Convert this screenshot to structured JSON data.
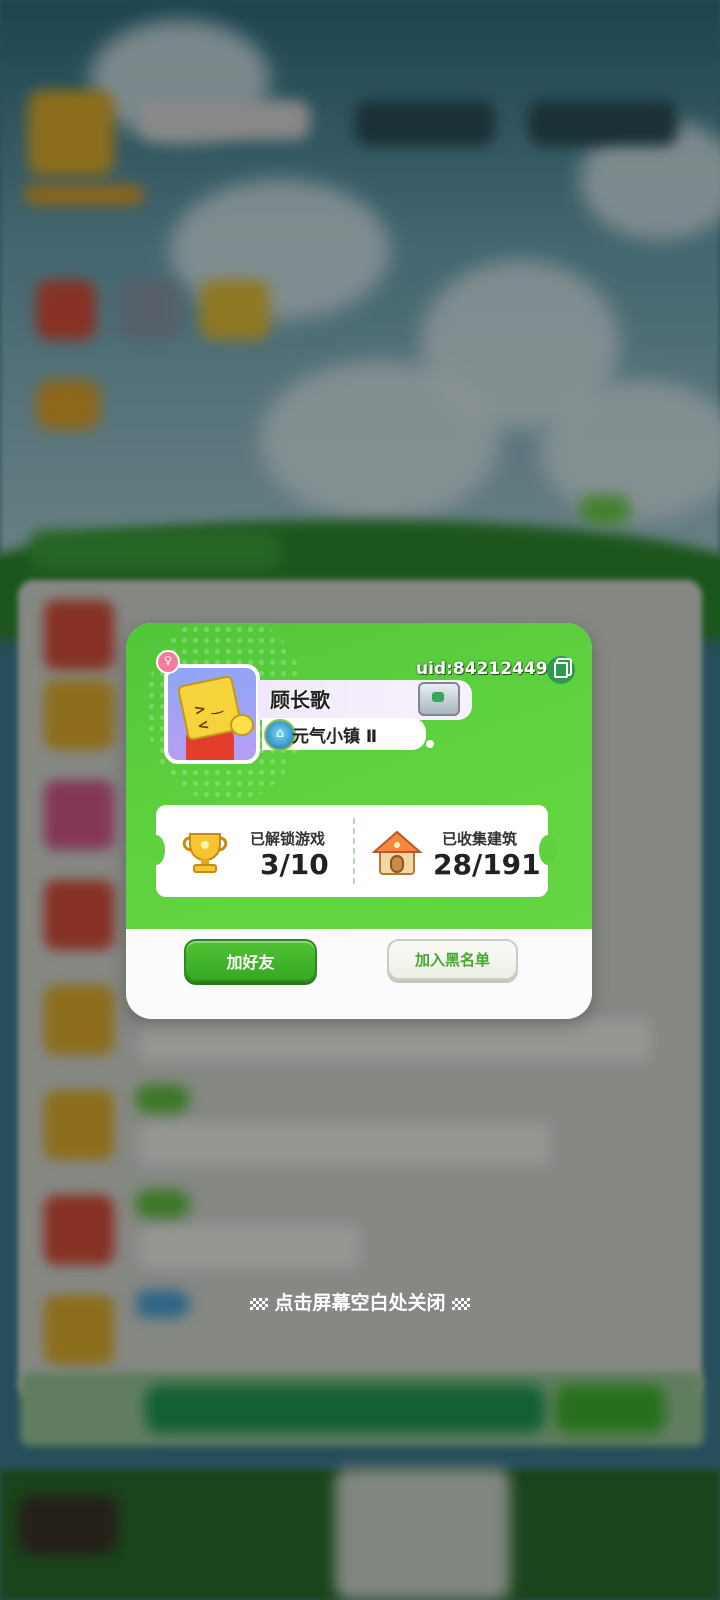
{
  "profile": {
    "uid_label": "uid:84212449",
    "name": "顾长歌",
    "town": "元气小镇 Ⅱ",
    "gender_symbol": "♀"
  },
  "stats": {
    "games_label": "已解锁游戏",
    "games_value": "3/10",
    "buildings_label": "已收集建筑",
    "buildings_value": "28/191"
  },
  "actions": {
    "add_friend": "加好友",
    "block": "加入黑名单"
  },
  "hint": {
    "close": "点击屏幕空白处关闭"
  },
  "colors": {
    "dialog_green": "#5fd13f",
    "button_green": "#3aab27",
    "block_text_green": "#48a52f"
  }
}
